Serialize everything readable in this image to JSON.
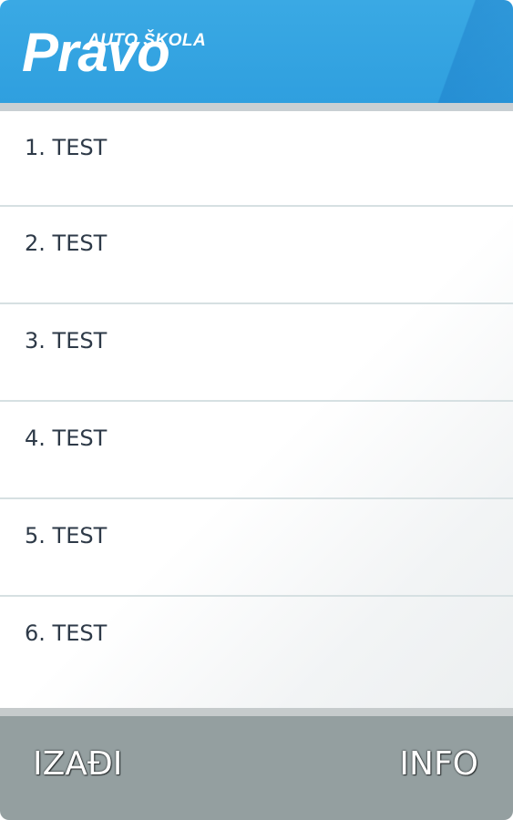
{
  "header": {
    "logo_small": "AUTO ŠKOLA",
    "logo_big": "Pravo",
    "background_color": "#3aa9e4"
  },
  "list": {
    "items": [
      {
        "label": "1. TEST"
      },
      {
        "label": "2. TEST"
      },
      {
        "label": "3. TEST"
      },
      {
        "label": "4. TEST"
      },
      {
        "label": "5. TEST"
      },
      {
        "label": "6. TEST"
      }
    ]
  },
  "footer": {
    "exit_label": "IZAĐI",
    "info_label": "INFO",
    "background_color": "#949fa0"
  }
}
